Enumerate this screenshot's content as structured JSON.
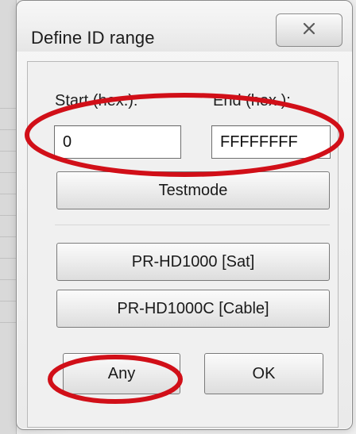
{
  "dialog": {
    "title": "Define ID range",
    "close_icon": "close-icon"
  },
  "fields": {
    "start_label": "Start (hex.):",
    "end_label": "End (hex.):",
    "start_value": "0",
    "end_value": "FFFFFFFF"
  },
  "buttons": {
    "testmode": "Testmode",
    "pr_hd1000_sat": "PR-HD1000 [Sat]",
    "pr_hd1000c_cable": "PR-HD1000C [Cable]",
    "any": "Any",
    "ok": "OK"
  },
  "annotations": {
    "highlight_color": "#d10f18"
  }
}
